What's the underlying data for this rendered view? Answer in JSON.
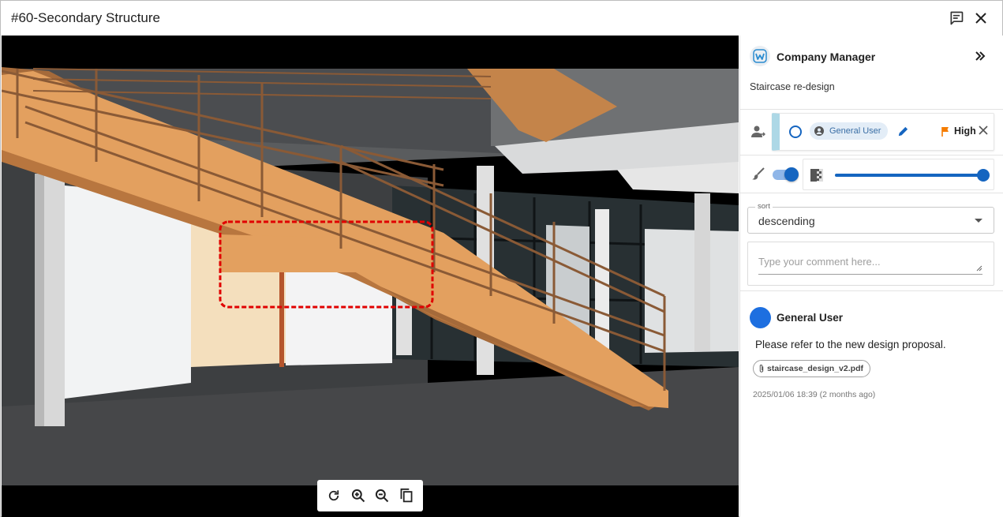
{
  "window": {
    "title": "#60-Secondary Structure",
    "actions": [
      {
        "name": "comments",
        "icon": "comment-icon"
      },
      {
        "name": "close",
        "icon": "close-icon"
      }
    ]
  },
  "viewer": {
    "toolbar": [
      {
        "name": "refresh",
        "icon": "refresh-icon"
      },
      {
        "name": "zoom-in",
        "icon": "zoom-in-icon"
      },
      {
        "name": "zoom-out",
        "icon": "zoom-out-icon"
      },
      {
        "name": "copy",
        "icon": "copy-icon"
      }
    ]
  },
  "panel": {
    "company": "Company Manager",
    "issue_title": "Staircase re-design",
    "assignee": {
      "name": "General User",
      "priority": "High",
      "status_color": "#add8e6",
      "priority_color": "#f57c00"
    },
    "visibility": {
      "enabled": true,
      "opacity": 1.0
    },
    "sort": {
      "label": "sort",
      "value": "descending"
    },
    "comment_input": {
      "placeholder": "Type your comment here..."
    },
    "comments": [
      {
        "author": "General User",
        "text": "Please refer to the new design proposal.",
        "attachment": "staircase_design_v2.pdf",
        "date": "2025/01/06 18:39 (2 months ago)"
      }
    ]
  },
  "colors": {
    "accent": "#1565c0",
    "markup": "#e00000"
  }
}
